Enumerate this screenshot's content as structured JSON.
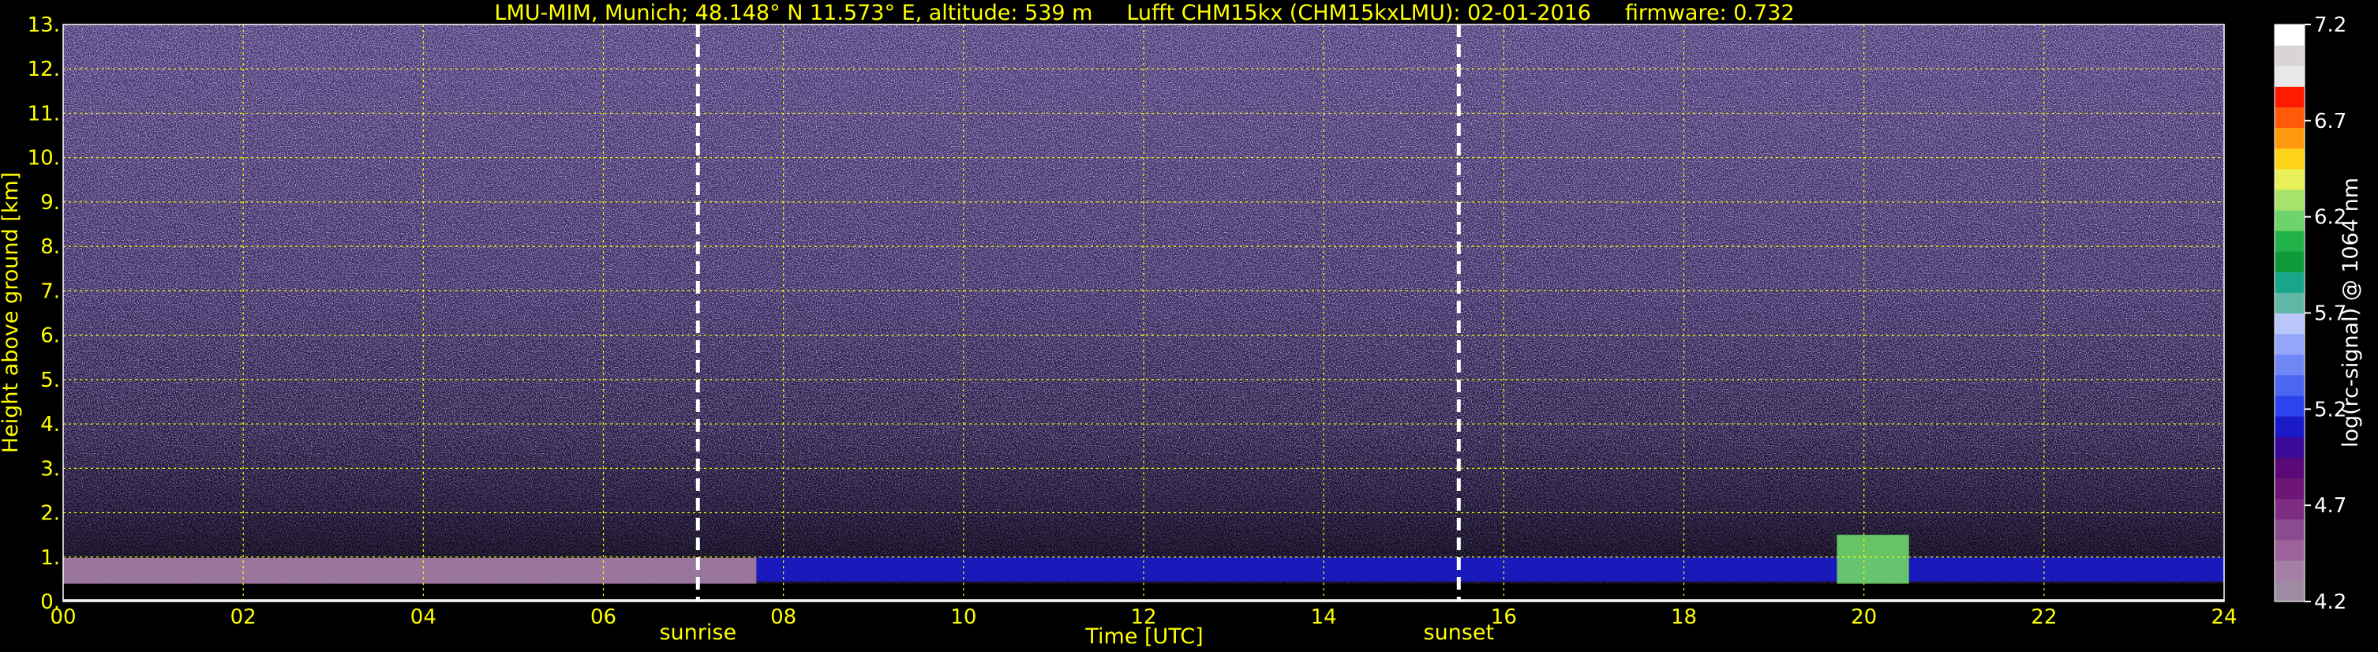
{
  "chart_data": {
    "type": "heatmap",
    "title": "LMU-MIM, Munich; 48.148° N 11.573° E, altitude: 539 m     Lufft CHM15kx (CHM15kxLMU): 02-01-2016     firmware: 0.732",
    "xlabel": "Time [UTC]",
    "ylabel": "Height above ground [km]",
    "xlim": [
      0,
      24
    ],
    "ylim": [
      0,
      13
    ],
    "x_ticks": [
      "00",
      "02",
      "04",
      "06",
      "08",
      "10",
      "12",
      "14",
      "16",
      "18",
      "20",
      "22",
      "24"
    ],
    "y_ticks": [
      "0.",
      "1.",
      "2.",
      "3.",
      "4.",
      "5.",
      "6.",
      "7.",
      "8.",
      "9.",
      "10.",
      "11.",
      "12.",
      "13."
    ],
    "grid": true,
    "events": [
      {
        "label": "sunrise",
        "time": 7.05
      },
      {
        "label": "sunset",
        "time": 15.5
      }
    ],
    "colorbar": {
      "label": "log(rc-signal) @ 1064 nm",
      "min": 4.2,
      "max": 7.2,
      "ticks": [
        "4.2",
        "4.7",
        "5.2",
        "5.7",
        "6.2",
        "6.7",
        "7.2"
      ],
      "colors": [
        "#9e8aa3",
        "#a67fa6",
        "#9c6299",
        "#8d4b8f",
        "#7d2e82",
        "#6d1675",
        "#5a0a78",
        "#3a0a99",
        "#1a1ac8",
        "#2a44ee",
        "#4b66f2",
        "#6f86f5",
        "#93a6f7",
        "#b8c6fa",
        "#5fb9a6",
        "#18a58a",
        "#0f9a3a",
        "#21b34a",
        "#6ed36a",
        "#a6e36a",
        "#e8f05a",
        "#ffd21a",
        "#ff9a10",
        "#ff5a08",
        "#ff1a00",
        "#e8e8e8",
        "#d9d4d6",
        "#ffffff"
      ]
    },
    "layers": [
      {
        "name": "pre-sunrise aerosol band",
        "t_start": 0.0,
        "t_end": 7.7,
        "h_bottom": 0.4,
        "h_top": 0.98,
        "level": 4.3
      },
      {
        "name": "boundary layer band",
        "t_start": 7.7,
        "t_end": 24.0,
        "h_bottom": 0.45,
        "h_top": 1.0,
        "level": 5.1
      },
      {
        "name": "cloud at 20 UTC",
        "t_start": 19.7,
        "t_end": 20.5,
        "h_bottom": 0.2,
        "h_top": 1.5,
        "level": 6.2
      }
    ]
  }
}
